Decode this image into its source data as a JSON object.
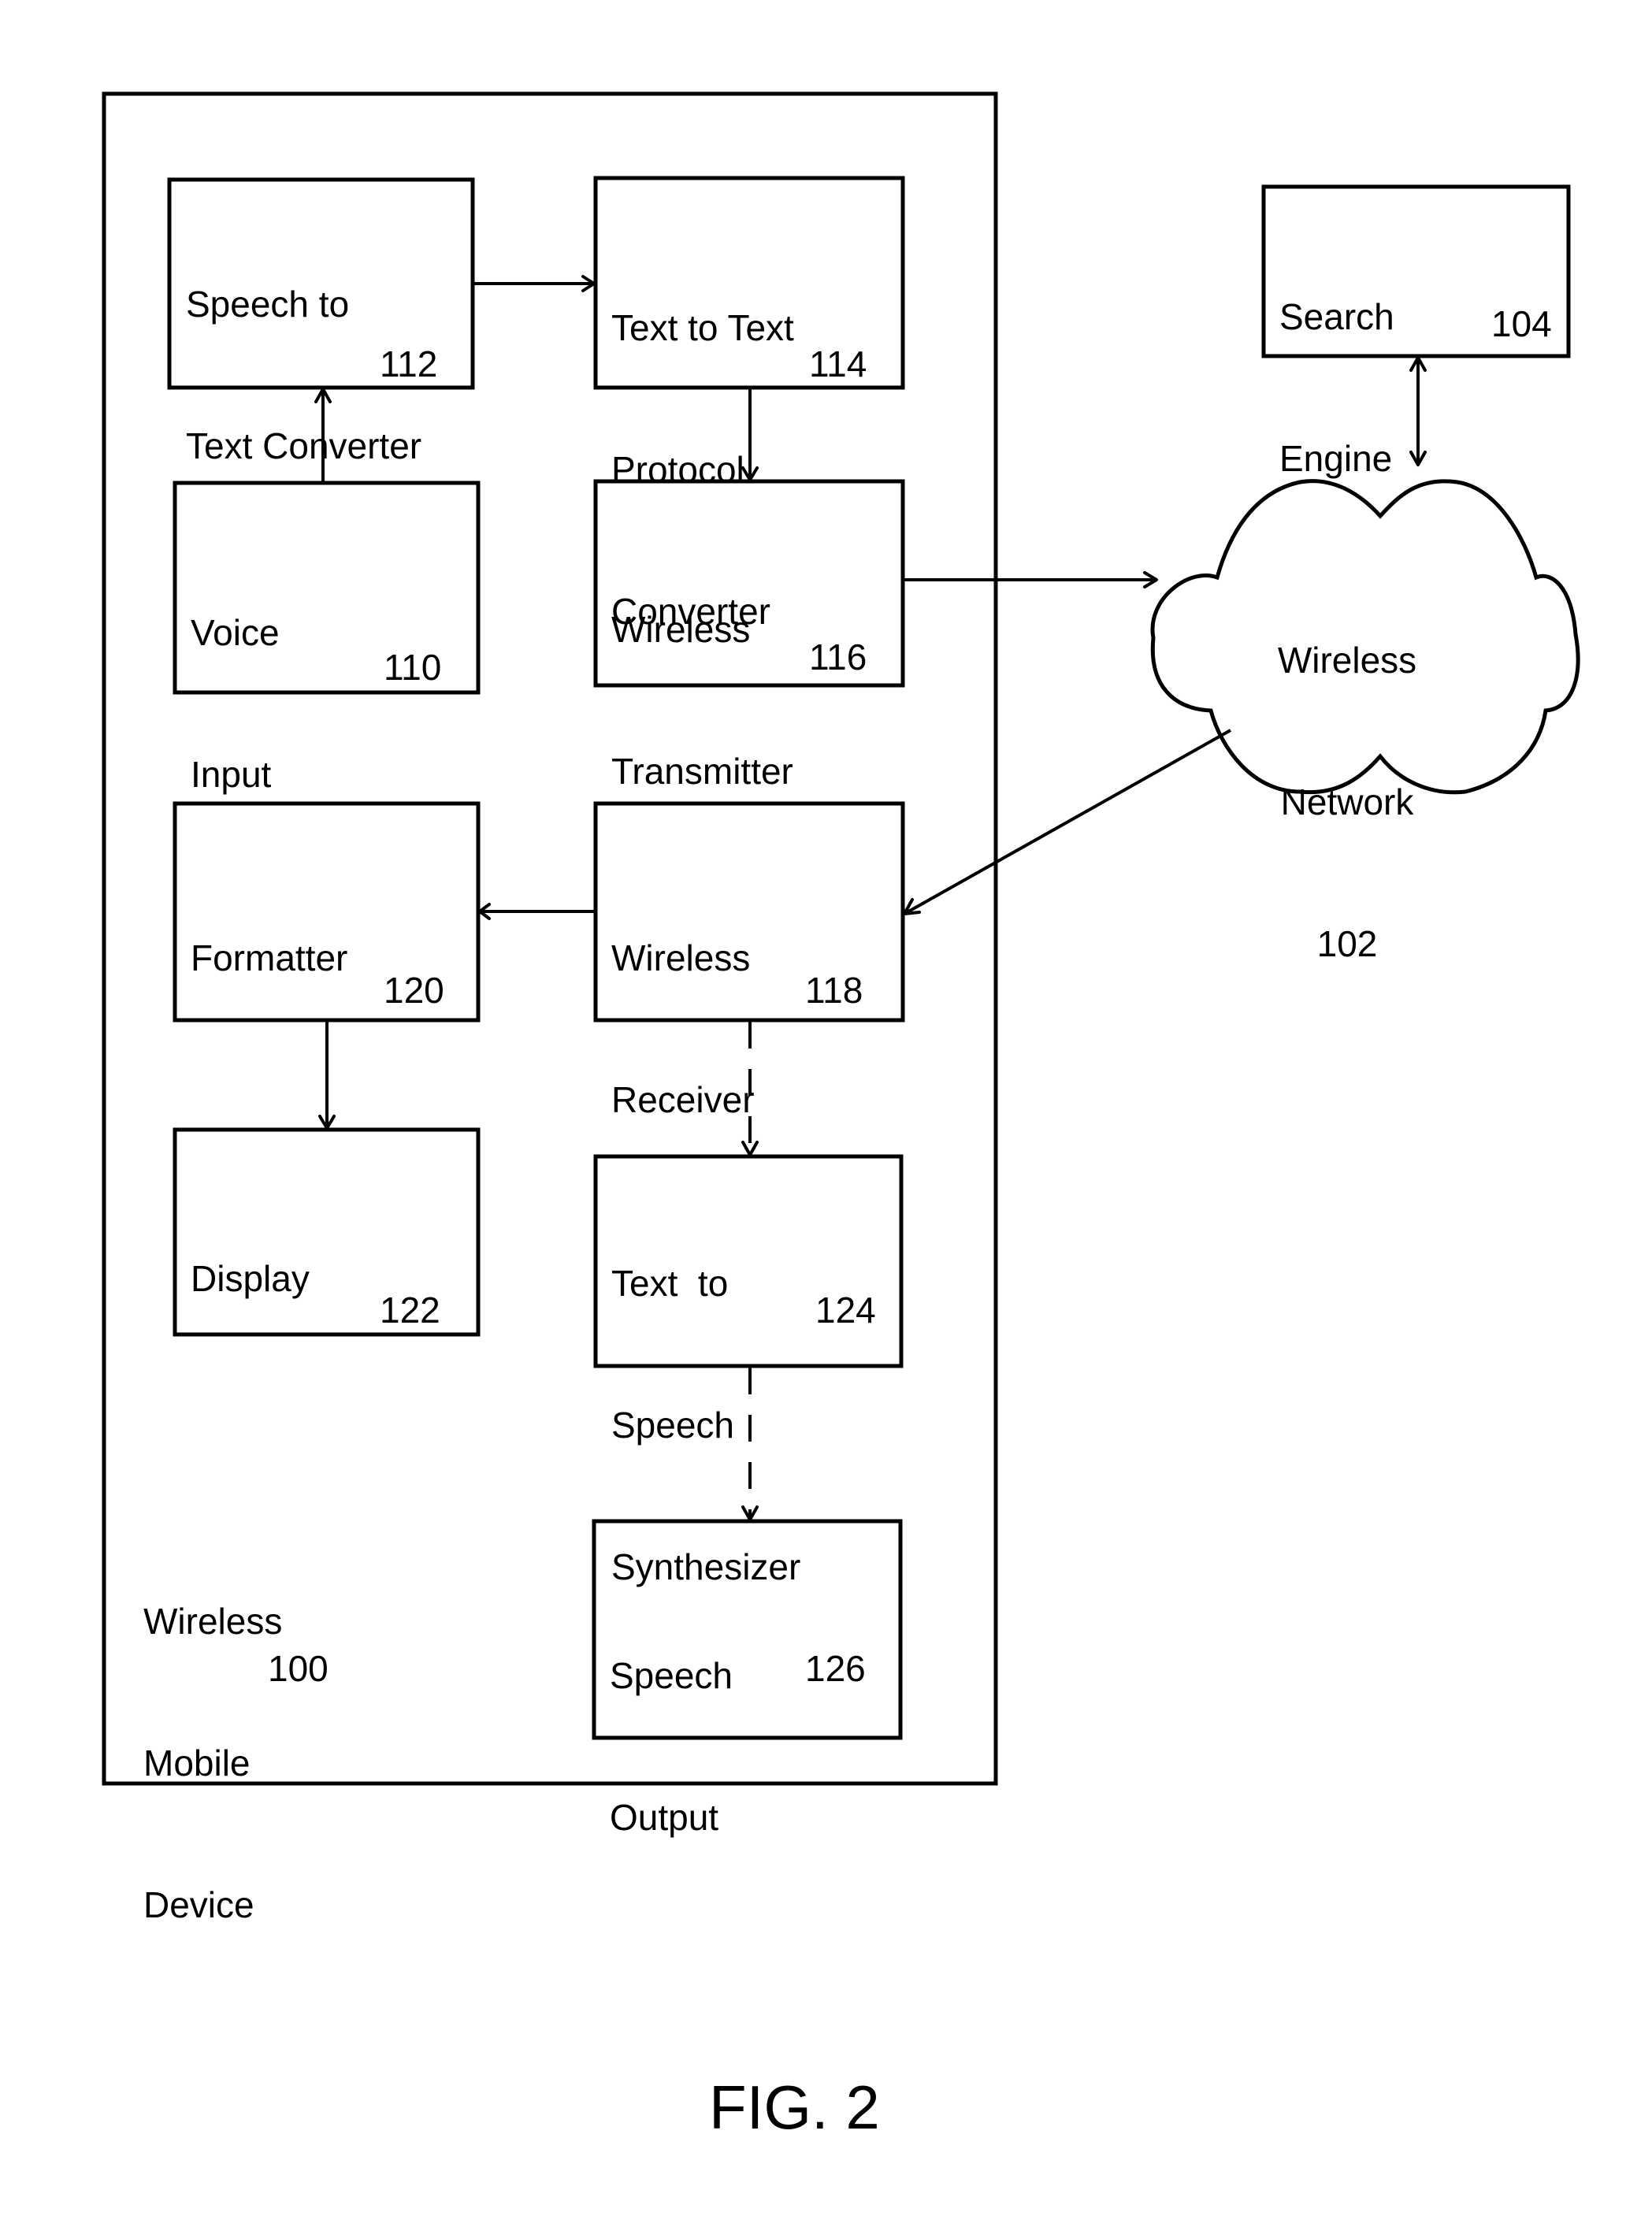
{
  "figure_label": "FIG. 2",
  "device": {
    "label_lines": [
      "Wireless",
      "Mobile",
      "Device"
    ],
    "ref": "100"
  },
  "blocks": {
    "speech_to_text": {
      "lines": [
        "Speech to",
        "Text Converter"
      ],
      "ref": "112"
    },
    "text_to_text": {
      "lines": [
        "Text to Text",
        "Protocol",
        "Converter"
      ],
      "ref": "114"
    },
    "voice_input": {
      "lines": [
        "Voice",
        "Input"
      ],
      "ref": "110"
    },
    "transmitter": {
      "lines": [
        "Wireless",
        "Transmitter"
      ],
      "ref": "116"
    },
    "formatter": {
      "lines": [
        "Formatter"
      ],
      "ref": "120"
    },
    "receiver": {
      "lines": [
        "Wireless",
        "Receiver"
      ],
      "ref": "118"
    },
    "display": {
      "lines": [
        "Display"
      ],
      "ref": "122"
    },
    "tts": {
      "lines": [
        "Text  to",
        "Speech",
        "Synthesizer"
      ],
      "ref": "124"
    },
    "speech_output": {
      "lines": [
        "Speech",
        "Output"
      ],
      "ref": "126"
    },
    "search_engine": {
      "lines": [
        "Search",
        "Engine"
      ],
      "ref": "104"
    }
  },
  "network": {
    "lines": [
      "Wireless",
      "Network"
    ],
    "ref": "102"
  },
  "connections": [
    {
      "from": "110",
      "to": "112",
      "style": "solid"
    },
    {
      "from": "112",
      "to": "114",
      "style": "solid"
    },
    {
      "from": "114",
      "to": "116",
      "style": "solid"
    },
    {
      "from": "116",
      "to": "102",
      "style": "solid"
    },
    {
      "from": "102",
      "to": "104",
      "style": "bidirectional"
    },
    {
      "from": "102",
      "to": "118",
      "style": "solid"
    },
    {
      "from": "118",
      "to": "120",
      "style": "solid"
    },
    {
      "from": "120",
      "to": "122",
      "style": "solid"
    },
    {
      "from": "118",
      "to": "124",
      "style": "dashed"
    },
    {
      "from": "124",
      "to": "126",
      "style": "dashed"
    }
  ]
}
